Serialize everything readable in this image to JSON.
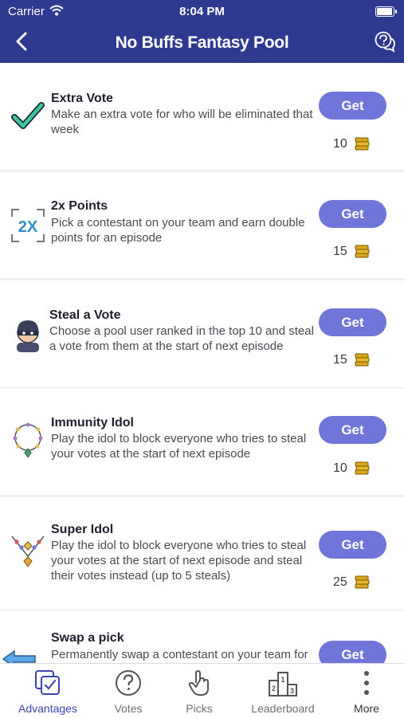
{
  "status_bar": {
    "carrier": "Carrier",
    "time": "8:04 PM"
  },
  "header": {
    "title": "No Buffs Fantasy Pool"
  },
  "advantages": [
    {
      "name": "Extra Vote",
      "description": "Make an extra vote for who will be eliminated that week",
      "button": "Get",
      "price": "10",
      "icon": "checkmark-icon"
    },
    {
      "name": "2x Points",
      "description": "Pick a contestant on your team and earn double points for an episode",
      "button": "Get",
      "price": "15",
      "icon": "double-points-icon"
    },
    {
      "name": "Steal a Vote",
      "description": "Choose a pool user ranked in the top 10 and steal a vote from them at the start of next episode",
      "button": "Get",
      "price": "15",
      "icon": "thief-icon"
    },
    {
      "name": "Immunity Idol",
      "description": "Play the idol to block everyone who tries to steal your votes at the start of next episode",
      "button": "Get",
      "price": "10",
      "icon": "necklace-icon"
    },
    {
      "name": "Super Idol",
      "description": "Play the idol to block everyone who tries to steal your votes at the start of next episode and steal their votes instead (up to 5 steals)",
      "button": "Get",
      "price": "25",
      "icon": "super-necklace-icon"
    },
    {
      "name": "Swap a pick",
      "description": "Permanently swap a contestant on your team for",
      "button": "Get",
      "price": "",
      "icon": "swap-arrow-icon"
    }
  ],
  "tabs": [
    {
      "label": "Advantages",
      "icon": "advantages-icon",
      "active": true
    },
    {
      "label": "Votes",
      "icon": "question-circle-icon",
      "active": false
    },
    {
      "label": "Picks",
      "icon": "hand-pointer-icon",
      "active": false
    },
    {
      "label": "Leaderboard",
      "icon": "podium-icon",
      "active": false
    },
    {
      "label": "More",
      "icon": "more-dots-icon",
      "active": false
    }
  ],
  "colors": {
    "header": "#2e3a8f",
    "button": "#6f75d9",
    "active_tab": "#3b46b0",
    "coin": "#d9a722"
  }
}
